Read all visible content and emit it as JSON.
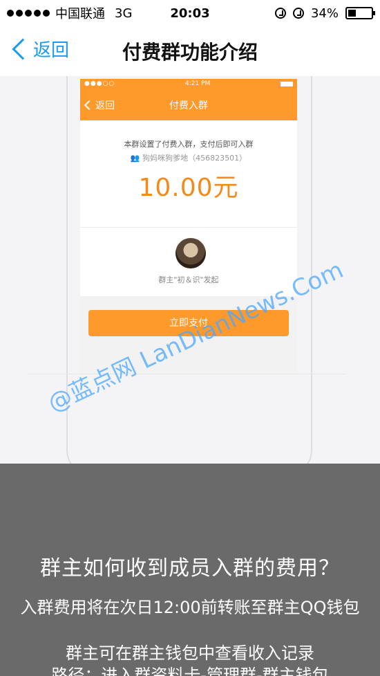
{
  "status_bar": {
    "carrier": "中国联通",
    "network": "3G",
    "time": "20:03",
    "battery_text": "34%",
    "battery_level": 0.34
  },
  "nav": {
    "back_label": "返回",
    "title": "付费群功能介绍"
  },
  "inner_screen": {
    "status_time": "4:21 PM",
    "back_label": "返回",
    "title": "付费入群",
    "description": "本群设置了付费入群，支付后即可入群",
    "group_name": "狗妈咪狗爹地（456823501）",
    "price": "10.00元",
    "owner_text": "群主\"初＆识\"发起",
    "pay_button": "立即支付"
  },
  "watermark": "@蓝点网 LanDianNews.Com",
  "panel": {
    "heading": "群主如何收到成员入群的费用？",
    "line1": "入群费用将在次日12:00前转账至群主QQ钱包",
    "line2": "群主可在群主钱包中查看收入记录",
    "line3": "路径：进入群资料卡-管理群-群主钱包"
  },
  "colors": {
    "accent_blue": "#1a9bf0",
    "orange": "#fd9a2b",
    "price_orange": "#f48a1a",
    "panel_gray": "#6a6a6a"
  }
}
